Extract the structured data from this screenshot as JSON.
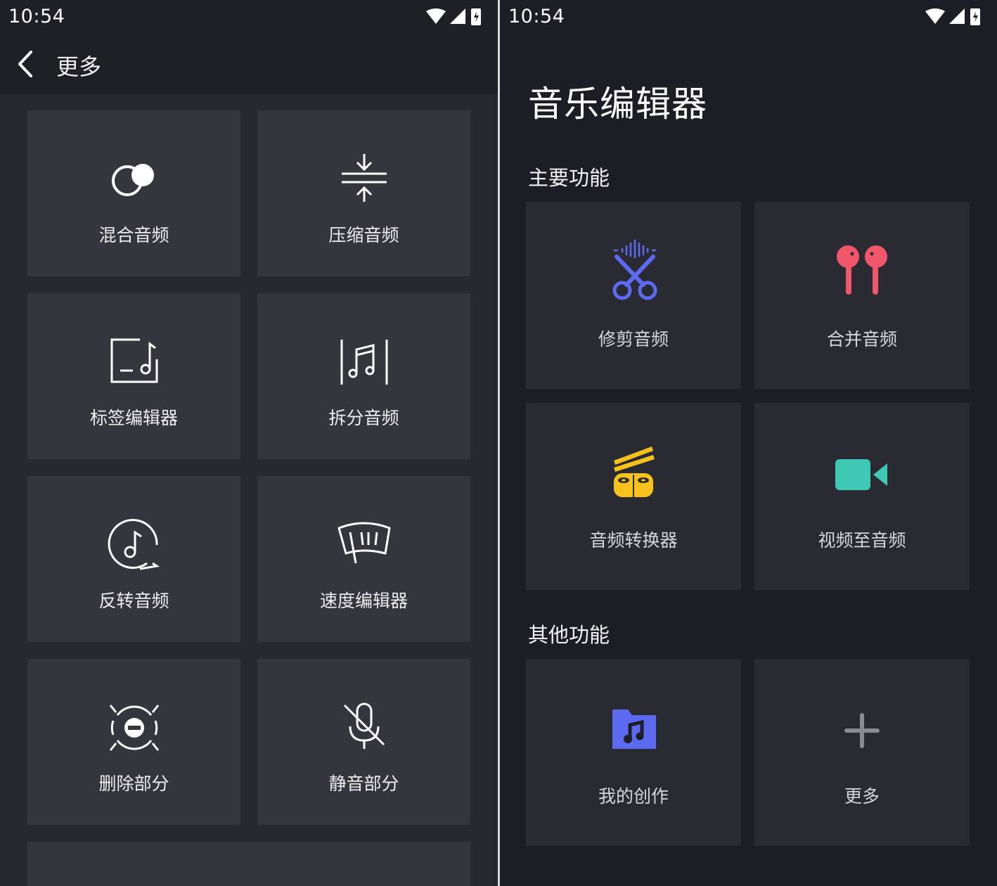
{
  "left": {
    "status_time": "10:54",
    "header_title": "更多",
    "tiles": [
      {
        "label": "混合音频",
        "icon": "mix-audio-icon"
      },
      {
        "label": "压缩音频",
        "icon": "compress-audio-icon"
      },
      {
        "label": "标签编辑器",
        "icon": "tag-editor-icon"
      },
      {
        "label": "拆分音频",
        "icon": "split-audio-icon"
      },
      {
        "label": "反转音频",
        "icon": "reverse-audio-icon"
      },
      {
        "label": "速度编辑器",
        "icon": "speed-editor-icon"
      },
      {
        "label": "删除部分",
        "icon": "delete-part-icon"
      },
      {
        "label": "静音部分",
        "icon": "mute-part-icon"
      }
    ]
  },
  "right": {
    "status_time": "10:54",
    "app_title": "音乐编辑器",
    "main_section_title": "主要功能",
    "main_tiles": [
      {
        "label": "修剪音频",
        "icon": "scissors-icon",
        "color": "#5b6af0"
      },
      {
        "label": "合并音频",
        "icon": "earbuds-icon",
        "color": "#f2566b"
      },
      {
        "label": "音频转换器",
        "icon": "converter-icon",
        "color": "#f7c21c"
      },
      {
        "label": "视频至音频",
        "icon": "video-camera-icon",
        "color": "#3ec9b6"
      }
    ],
    "other_section_title": "其他功能",
    "other_tiles": [
      {
        "label": "我的创作",
        "icon": "music-folder-icon",
        "color": "#5b6af0"
      },
      {
        "label": "更多",
        "icon": "plus-icon",
        "color": "#8a8a92"
      }
    ]
  }
}
